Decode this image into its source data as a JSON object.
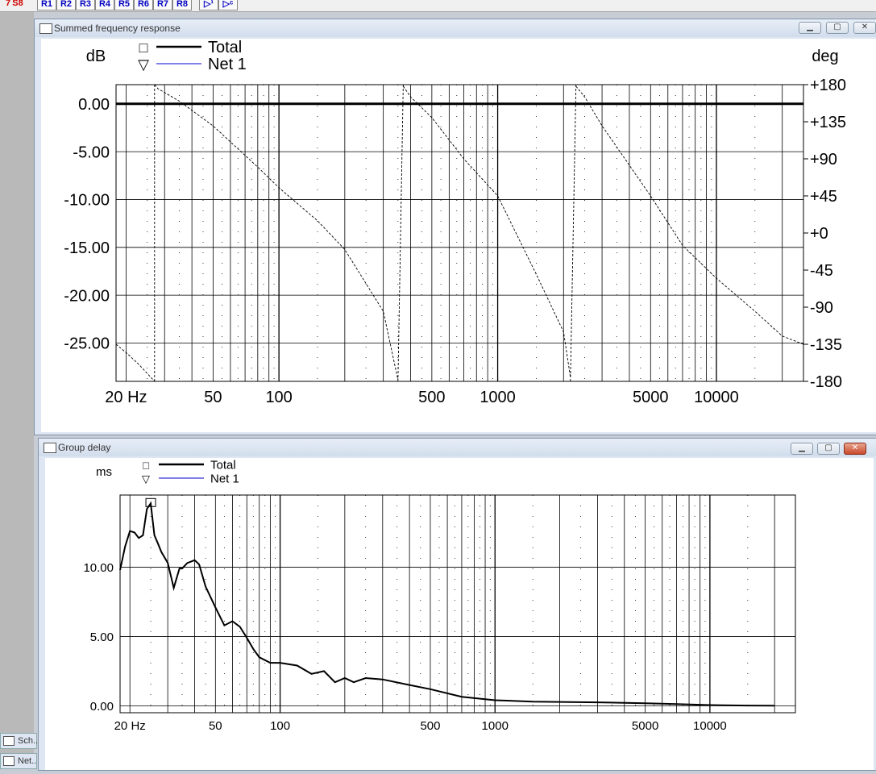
{
  "toolbar": {
    "items": [
      "7",
      "S8",
      "R1",
      "R2",
      "R3",
      "R4",
      "R5",
      "R6",
      "R7",
      "R8",
      "▷¹",
      "▷ᶜ"
    ]
  },
  "window1": {
    "title": "Summed frequency response",
    "y_unit_left": "dB",
    "y_unit_right": "deg",
    "legend": [
      {
        "marker": "□",
        "label": "Total",
        "color": "#000000"
      },
      {
        "marker": "▽",
        "label": "Net 1",
        "color": "#0000cc"
      }
    ]
  },
  "window2": {
    "title": "Group delay",
    "y_unit_left": "ms",
    "legend": [
      {
        "marker": "□",
        "label": "Total",
        "color": "#000000"
      },
      {
        "marker": "▽",
        "label": "Net 1",
        "color": "#0000cc"
      }
    ]
  },
  "taskbar": {
    "items": [
      "Sch..",
      "Net.."
    ]
  },
  "chart_data": [
    {
      "type": "line",
      "title": "Summed frequency response",
      "xscale": "log",
      "xlim": [
        18,
        25000
      ],
      "x_ticks": [
        "20 Hz",
        "50",
        "100",
        "500",
        "1000",
        "5000",
        "10000"
      ],
      "ylabel_left": "dB",
      "ylim_left": [
        -29,
        2
      ],
      "y_ticks_left": [
        "0.00",
        "-5.00",
        "-10.00",
        "-15.00",
        "-20.00",
        "-25.00"
      ],
      "ylabel_right": "deg",
      "ylim_right": [
        -180,
        180
      ],
      "y_ticks_right": [
        "+180",
        "+135",
        "+90",
        "+45",
        "+0",
        "-45",
        "-90",
        "-135",
        "-180"
      ],
      "grid": true,
      "legend_position": "top",
      "series": [
        {
          "name": "Total",
          "axis": "left",
          "color": "#000000",
          "x": [
            18,
            25000
          ],
          "y": [
            0,
            0
          ]
        },
        {
          "name": "Total phase",
          "axis": "right",
          "color": "#000000",
          "style": "dashed",
          "segments": [
            {
              "x": [
                18,
                20,
                23,
                27
              ],
              "y": [
                -135,
                -145,
                -160,
                -180
              ]
            },
            {
              "x": [
                27,
                28,
                35,
                50,
                80,
                100,
                150,
                200,
                300,
                350
              ],
              "y": [
                180,
                175,
                160,
                130,
                80,
                55,
                15,
                -20,
                -95,
                -178
              ]
            },
            {
              "x": [
                370,
                400,
                500,
                700,
                1000,
                1500,
                2000,
                2150
              ],
              "y": [
                178,
                165,
                140,
                90,
                45,
                -50,
                -120,
                -175
              ]
            },
            {
              "x": [
                2280,
                2500,
                3000,
                5000,
                7000,
                10000,
                15000,
                20000,
                25000
              ],
              "y": [
                178,
                165,
                130,
                45,
                -15,
                -55,
                -95,
                -125,
                -135
              ]
            }
          ]
        }
      ]
    },
    {
      "type": "line",
      "title": "Group delay",
      "xscale": "log",
      "xlim": [
        18,
        25000
      ],
      "x_ticks": [
        "20 Hz",
        "50",
        "100",
        "500",
        "1000",
        "5000",
        "10000"
      ],
      "ylabel": "ms",
      "ylim": [
        -0.5,
        15.2
      ],
      "y_ticks": [
        "0.00",
        "5.00",
        "10.00"
      ],
      "grid": true,
      "legend_position": "top",
      "series": [
        {
          "name": "Total",
          "color": "#000000",
          "x": [
            18,
            19,
            20,
            21,
            22,
            23,
            24,
            25,
            26,
            27,
            28,
            30,
            32,
            34,
            35,
            37,
            40,
            42,
            45,
            50,
            55,
            60,
            65,
            70,
            75,
            80,
            90,
            100,
            120,
            140,
            160,
            180,
            200,
            220,
            250,
            300,
            400,
            500,
            700,
            1000,
            1500,
            2000,
            3000,
            5000,
            7000,
            10000,
            15000,
            20000
          ],
          "y": [
            9.8,
            11.5,
            12.6,
            12.5,
            12.1,
            12.3,
            14.2,
            14.6,
            12.3,
            11.7,
            11.1,
            10.3,
            8.5,
            9.9,
            9.9,
            10.3,
            10.5,
            10.2,
            8.6,
            7.1,
            5.8,
            6.1,
            5.7,
            4.9,
            4.1,
            3.5,
            3.1,
            3.1,
            2.9,
            2.3,
            2.5,
            1.7,
            2.0,
            1.7,
            2.0,
            1.9,
            1.5,
            1.2,
            0.65,
            0.4,
            0.3,
            0.28,
            0.25,
            0.18,
            0.12,
            0.05,
            0.02,
            0.01
          ]
        }
      ]
    }
  ]
}
